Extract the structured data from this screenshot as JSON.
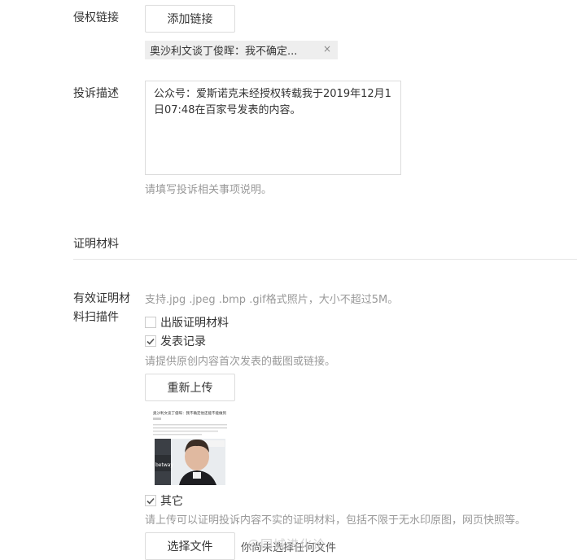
{
  "infringing_link": {
    "label": "侵权链接",
    "add_button": "添加链接",
    "tag_text": "奥沙利文谈丁俊晖：我不确定...",
    "tag_close": "×"
  },
  "complaint": {
    "label": "投诉描述",
    "text": "公众号：爱斯诺克未经授权转载我于2019年12月1日07:48在百家号发表的内容。",
    "hint": "请填写投诉相关事项说明。"
  },
  "evidence_section": {
    "title": "证明材料"
  },
  "scans": {
    "label_line1": "有效证明材",
    "label_line2": "料扫描件",
    "format_hint": "支持.jpg .jpeg .bmp .gif格式照片，大小不超过5M。",
    "options": [
      {
        "label": "出版证明材料",
        "checked": false
      },
      {
        "label": "发表记录",
        "checked": true
      }
    ],
    "publish_hint": "请提供原创内容首次发表的截图或链接。",
    "reupload_button": "重新上传",
    "other_option": {
      "label": "其它",
      "checked": true
    },
    "other_hint": "请上传可以证明投诉内容不实的证明材料，包括不限于无水印原图，网页快照等。",
    "choose_file_button": "选择文件",
    "file_status": "你尚未选择任何文件"
  },
  "watermark": "@同城进化论",
  "thumbnail": {
    "headline": "奥沙利文谈丁俊晖：我不确定他还能不能做到",
    "brand_text": "betway"
  },
  "colors": {
    "text": "#333333",
    "hint": "#999999",
    "border": "#dcdcdc",
    "tag_bg": "#eeeeee"
  }
}
